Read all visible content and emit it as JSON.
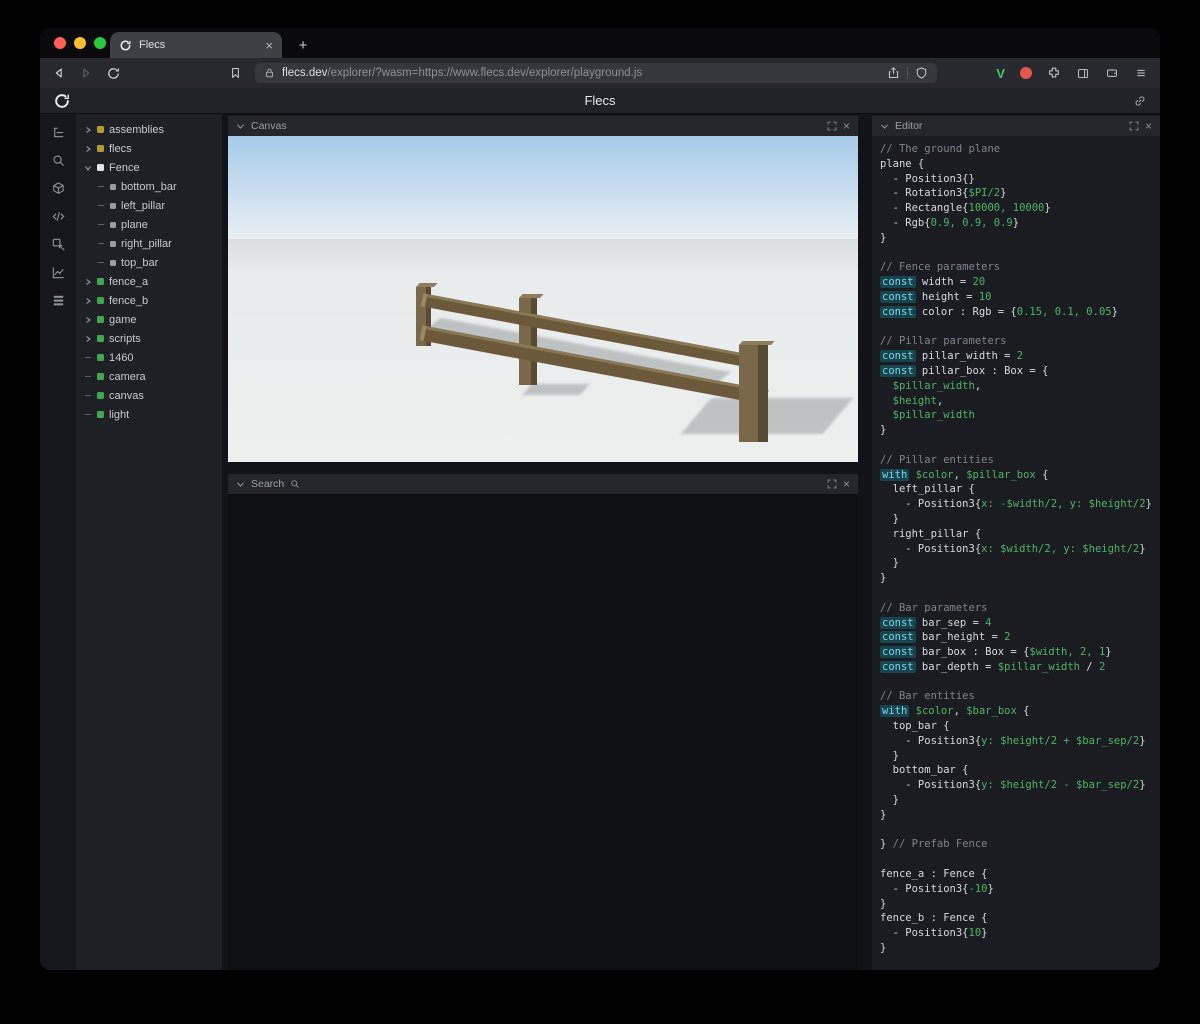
{
  "theme": {
    "traffic_red": "#ff5f57",
    "traffic_yellow": "#febc2e",
    "traffic_green": "#28c840",
    "entity_yellow": "#b29a2e",
    "entity_green": "#3fa84f",
    "entity_white": "#e3e5e8",
    "entity_gray": "#989da4",
    "code_comment": "#7d838d",
    "code_text": "#d6d9dd",
    "code_green": "#4db564",
    "code_keyword": "#7ed4e6",
    "code_keyword_bg": "#17454f",
    "fence_brown": "#6c593b",
    "sky_blue": "#a6cae9"
  },
  "ui": {
    "close_glyph": "×",
    "new_tab_glyph": "+"
  },
  "browser": {
    "tab_title": "Flecs",
    "url_domain": "flecs.dev",
    "url_path": "/explorer/?wasm=https://www.flecs.dev/explorer/playground.js",
    "toolbar_icons": [
      "back-icon",
      "forward-icon",
      "reload-icon",
      "bookmark-icon",
      "lock-icon",
      "share-icon",
      "shield-icon",
      "v-extension-icon",
      "record-extension-icon",
      "extensions-puzzle-icon",
      "sidebar-icon",
      "wallet-icon",
      "menu-icon"
    ]
  },
  "app": {
    "title": "Flecs"
  },
  "rail": {
    "icons": [
      "tree",
      "search",
      "cube",
      "code",
      "inspect",
      "chart",
      "stats"
    ]
  },
  "panels": {
    "canvas": {
      "title": "Canvas"
    },
    "search": {
      "title": "Search"
    },
    "editor": {
      "title": "Editor"
    }
  },
  "tree": {
    "items": [
      {
        "label": "assemblies",
        "arrow": "right",
        "color": "yellow",
        "depth": 0
      },
      {
        "label": "flecs",
        "arrow": "right",
        "color": "yellow",
        "depth": 0
      },
      {
        "label": "Fence",
        "arrow": "down",
        "color": "white",
        "depth": 0
      },
      {
        "label": "bottom_bar",
        "arrow": "none",
        "color": "gray",
        "depth": 1
      },
      {
        "label": "left_pillar",
        "arrow": "none",
        "color": "gray",
        "depth": 1
      },
      {
        "label": "plane",
        "arrow": "none",
        "color": "gray",
        "depth": 1
      },
      {
        "label": "right_pillar",
        "arrow": "none",
        "color": "gray",
        "depth": 1
      },
      {
        "label": "top_bar",
        "arrow": "none",
        "color": "gray",
        "depth": 1
      },
      {
        "label": "fence_a",
        "arrow": "right",
        "color": "green",
        "depth": 0
      },
      {
        "label": "fence_b",
        "arrow": "right",
        "color": "green",
        "depth": 0
      },
      {
        "label": "game",
        "arrow": "right",
        "color": "green",
        "depth": 0
      },
      {
        "label": "scripts",
        "arrow": "right",
        "color": "green",
        "depth": 0
      },
      {
        "label": "1460",
        "arrow": "none",
        "color": "green",
        "depth": 0
      },
      {
        "label": "camera",
        "arrow": "none",
        "color": "green",
        "depth": 0
      },
      {
        "label": "canvas",
        "arrow": "none",
        "color": "green",
        "depth": 0
      },
      {
        "label": "light",
        "arrow": "none",
        "color": "green",
        "depth": 0
      }
    ]
  },
  "editor": {
    "lines": [
      [
        [
          "c",
          "// The ground plane"
        ]
      ],
      [
        [
          "w",
          "plane {"
        ]
      ],
      [
        [
          "w",
          "  - Position3{}"
        ]
      ],
      [
        [
          "w",
          "  - Rotation3{"
        ],
        [
          "g",
          "$PI/2"
        ],
        [
          "w",
          "}"
        ]
      ],
      [
        [
          "w",
          "  - Rectangle{"
        ],
        [
          "g",
          "10000, 10000"
        ],
        [
          "w",
          "}"
        ]
      ],
      [
        [
          "w",
          "  - Rgb{"
        ],
        [
          "g",
          "0.9, 0.9, 0.9"
        ],
        [
          "w",
          "}"
        ]
      ],
      [
        [
          "w",
          "}"
        ]
      ],
      [],
      [
        [
          "c",
          "// Fence parameters"
        ]
      ],
      [
        [
          "k",
          "const"
        ],
        [
          "w",
          " width = "
        ],
        [
          "g",
          "20"
        ]
      ],
      [
        [
          "k",
          "const"
        ],
        [
          "w",
          " height = "
        ],
        [
          "g",
          "10"
        ]
      ],
      [
        [
          "k",
          "const"
        ],
        [
          "w",
          " color : Rgb = {"
        ],
        [
          "g",
          "0.15, 0.1, 0.05"
        ],
        [
          "w",
          "}"
        ]
      ],
      [],
      [
        [
          "c",
          "// Pillar parameters"
        ]
      ],
      [
        [
          "k",
          "const"
        ],
        [
          "w",
          " pillar_width = "
        ],
        [
          "g",
          "2"
        ]
      ],
      [
        [
          "k",
          "const"
        ],
        [
          "w",
          " pillar_box : Box = {"
        ]
      ],
      [
        [
          "g",
          "  $pillar_width"
        ],
        [
          "w",
          ","
        ]
      ],
      [
        [
          "g",
          "  $height"
        ],
        [
          "w",
          ","
        ]
      ],
      [
        [
          "g",
          "  $pillar_width"
        ]
      ],
      [
        [
          "w",
          "}"
        ]
      ],
      [],
      [
        [
          "c",
          "// Pillar entities"
        ]
      ],
      [
        [
          "k",
          "with"
        ],
        [
          "w",
          " "
        ],
        [
          "g",
          "$color"
        ],
        [
          "w",
          ", "
        ],
        [
          "g",
          "$pillar_box"
        ],
        [
          "w",
          " {"
        ]
      ],
      [
        [
          "w",
          "  left_pillar {"
        ]
      ],
      [
        [
          "w",
          "    - Position3{"
        ],
        [
          "g",
          "x: -$width/2, y: $height/2"
        ],
        [
          "w",
          "}"
        ]
      ],
      [
        [
          "w",
          "  }"
        ]
      ],
      [
        [
          "w",
          "  right_pillar {"
        ]
      ],
      [
        [
          "w",
          "    - Position3{"
        ],
        [
          "g",
          "x: $width/2, y: $height/2"
        ],
        [
          "w",
          "}"
        ]
      ],
      [
        [
          "w",
          "  }"
        ]
      ],
      [
        [
          "w",
          "}"
        ]
      ],
      [],
      [
        [
          "c",
          "// Bar parameters"
        ]
      ],
      [
        [
          "k",
          "const"
        ],
        [
          "w",
          " bar_sep = "
        ],
        [
          "g",
          "4"
        ]
      ],
      [
        [
          "k",
          "const"
        ],
        [
          "w",
          " bar_height = "
        ],
        [
          "g",
          "2"
        ]
      ],
      [
        [
          "k",
          "const"
        ],
        [
          "w",
          " bar_box : Box = {"
        ],
        [
          "g",
          "$width, 2, 1"
        ],
        [
          "w",
          "}"
        ]
      ],
      [
        [
          "k",
          "const"
        ],
        [
          "w",
          " bar_depth = "
        ],
        [
          "g",
          "$pillar_width"
        ],
        [
          "w",
          " / "
        ],
        [
          "g",
          "2"
        ]
      ],
      [],
      [
        [
          "c",
          "// Bar entities"
        ]
      ],
      [
        [
          "k",
          "with"
        ],
        [
          "w",
          " "
        ],
        [
          "g",
          "$color"
        ],
        [
          "w",
          ", "
        ],
        [
          "g",
          "$bar_box"
        ],
        [
          "w",
          " {"
        ]
      ],
      [
        [
          "w",
          "  top_bar {"
        ]
      ],
      [
        [
          "w",
          "    - Position3{"
        ],
        [
          "g",
          "y: $height/2 + $bar_sep/2"
        ],
        [
          "w",
          "}"
        ]
      ],
      [
        [
          "w",
          "  }"
        ]
      ],
      [
        [
          "w",
          "  bottom_bar {"
        ]
      ],
      [
        [
          "w",
          "    - Position3{"
        ],
        [
          "g",
          "y: $height/2 - $bar_sep/2"
        ],
        [
          "w",
          "}"
        ]
      ],
      [
        [
          "w",
          "  }"
        ]
      ],
      [
        [
          "w",
          "}"
        ]
      ],
      [],
      [
        [
          "w",
          "} "
        ],
        [
          "c",
          "// Prefab Fence"
        ]
      ],
      [],
      [
        [
          "w",
          "fence_a : Fence {"
        ]
      ],
      [
        [
          "w",
          "  - Position3{"
        ],
        [
          "g",
          "-10"
        ],
        [
          "w",
          "}"
        ]
      ],
      [
        [
          "w",
          "}"
        ]
      ],
      [
        [
          "w",
          "fence_b : Fence {"
        ]
      ],
      [
        [
          "w",
          "  - Position3{"
        ],
        [
          "g",
          "10"
        ],
        [
          "w",
          "}"
        ]
      ],
      [
        [
          "w",
          "}"
        ]
      ]
    ]
  }
}
